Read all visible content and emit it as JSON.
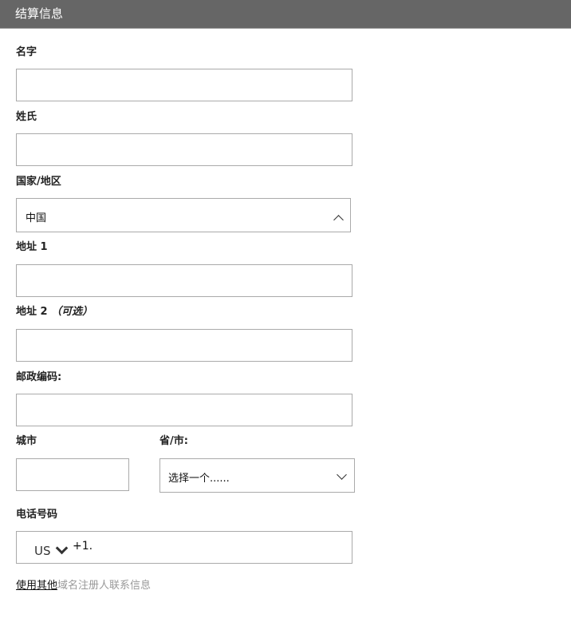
{
  "header": {
    "title": "结算信息"
  },
  "fields": {
    "first_name": {
      "label": "名字"
    },
    "last_name": {
      "label": "姓氏"
    },
    "country": {
      "label": "国家/地区",
      "value": "中国"
    },
    "address1": {
      "label": "地址 1"
    },
    "address2": {
      "label": "地址 2",
      "optional": "（可选）"
    },
    "postal": {
      "label": "邮政编码:"
    },
    "city": {
      "label": "城市"
    },
    "province": {
      "label": "省/市:",
      "value": "选择一个......"
    },
    "phone": {
      "label": "电话号码",
      "country_code": "US",
      "prefix": "+1."
    }
  },
  "footer": {
    "link": "使用其他",
    "rest": "域名注册人联系信息"
  }
}
